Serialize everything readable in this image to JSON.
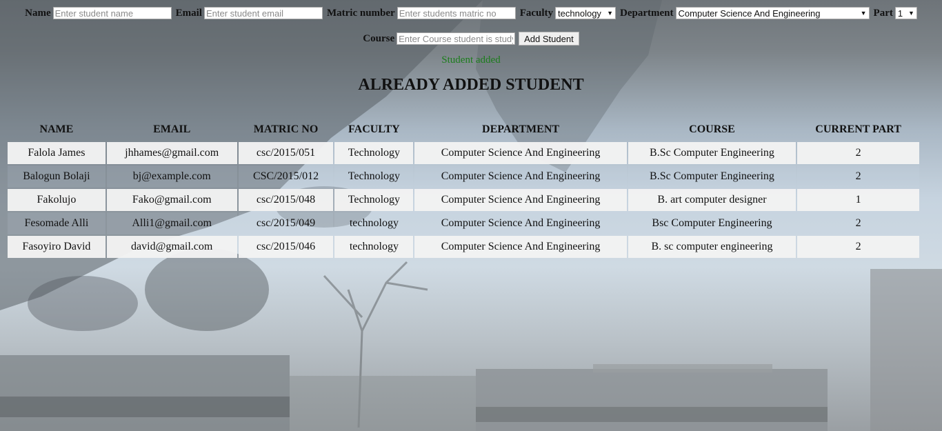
{
  "form": {
    "name_label": "Name",
    "name_placeholder": "Enter student name",
    "email_label": "Email",
    "email_placeholder": "Enter student email",
    "matric_label": "Matric number",
    "matric_placeholder": "Enter students matric no",
    "faculty_label": "Faculty",
    "faculty_selected": "technology",
    "department_label": "Department",
    "department_selected": "Computer Science And Engineering",
    "part_label": "Part",
    "part_selected": "1",
    "course_label": "Course",
    "course_placeholder": "Enter Course student is studying",
    "add_button": "Add Student"
  },
  "status_message": "Student added",
  "heading": "ALREADY ADDED STUDENT",
  "table": {
    "headers": [
      "NAME",
      "EMAIL",
      "MATRIC NO",
      "FACULTY",
      "DEPARTMENT",
      "COURSE",
      "CURRENT PART"
    ],
    "rows": [
      [
        "Falola James",
        "jhhames@gmail.com",
        "csc/2015/051",
        "Technology",
        "Computer Science And Engineering",
        "B.Sc Computer Engineering",
        "2"
      ],
      [
        "Balogun Bolaji",
        "bj@example.com",
        "CSC/2015/012",
        "Technology",
        "Computer Science And Engineering",
        "B.Sc Computer Engineering",
        "2"
      ],
      [
        "Fakolujo",
        "Fako@gmail.com",
        "csc/2015/048",
        "Technology",
        "Computer Science And Engineering",
        "B. art computer designer",
        "1"
      ],
      [
        "Fesomade Alli",
        "Alli1@gmail.com",
        "csc/2015/049",
        "technology",
        "Computer Science And Engineering",
        "Bsc Computer Engineering",
        "2"
      ],
      [
        "Fasoyiro David",
        "david@gmail.com",
        "csc/2015/046",
        "technology",
        "Computer Science And Engineering",
        "B. sc computer engineering",
        "2"
      ]
    ]
  },
  "colors": {
    "status_green": "#1b7d1b",
    "row_stripe": "#f2f2f2"
  },
  "icons": {
    "dropdown": "chevron-down-icon"
  }
}
